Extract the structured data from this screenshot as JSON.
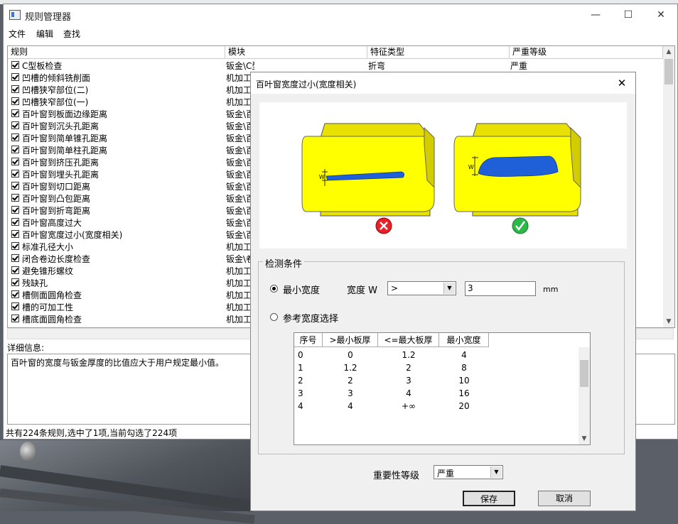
{
  "main_window": {
    "title": "规则管理器",
    "menu": [
      "文件",
      "编辑",
      "查找"
    ],
    "columns": [
      "规则",
      "模块",
      "特征类型",
      "严重等级"
    ],
    "rows": [
      {
        "rule": "C型板检查",
        "module": "钣金\\C型板",
        "feature": "折弯",
        "severity": "严重"
      },
      {
        "rule": "凹槽的倾斜铣削面",
        "module": "机加工"
      },
      {
        "rule": "凹槽狭窄部位(二)",
        "module": "机加工"
      },
      {
        "rule": "凹槽狭窄部位(一)",
        "module": "机加工"
      },
      {
        "rule": "百叶窗到板面边缘距离",
        "module": "钣金\\百"
      },
      {
        "rule": "百叶窗到沉头孔距离",
        "module": "钣金\\百"
      },
      {
        "rule": "百叶窗到简单锥孔距离",
        "module": "钣金\\百"
      },
      {
        "rule": "百叶窗到简单柱孔距离",
        "module": "钣金\\百"
      },
      {
        "rule": "百叶窗到挤压孔距离",
        "module": "钣金\\百"
      },
      {
        "rule": "百叶窗到埋头孔距离",
        "module": "钣金\\百"
      },
      {
        "rule": "百叶窗到切口距离",
        "module": "钣金\\百"
      },
      {
        "rule": "百叶窗到凸包距离",
        "module": "钣金\\百"
      },
      {
        "rule": "百叶窗到折弯距离",
        "module": "钣金\\百"
      },
      {
        "rule": "百叶窗高度过大",
        "module": "钣金\\百"
      },
      {
        "rule": "百叶窗宽度过小(宽度相关)",
        "module": "钣金\\百"
      },
      {
        "rule": "标准孔径大小",
        "module": "机加工"
      },
      {
        "rule": "闭合卷边长度检查",
        "module": "钣金\\卷"
      },
      {
        "rule": "避免锥形螺纹",
        "module": "机加工"
      },
      {
        "rule": "残缺孔",
        "module": "机加工"
      },
      {
        "rule": "槽侧面圆角检查",
        "module": "机加工"
      },
      {
        "rule": "槽的可加工性",
        "module": "机加工"
      },
      {
        "rule": "槽底面圆角检查",
        "module": "机加工"
      }
    ],
    "detail_label": "详细信息:",
    "detail_text": "百叶窗的宽度与钣金厚度的比值应大于用户规定最小值。",
    "status": "共有224条规则,选中了1项,当前勾选了224项"
  },
  "dialog": {
    "title": "百叶窗宽度过小(宽度相关)",
    "group_label": "检测条件",
    "option_min": "最小宽度",
    "width_label": "宽度 W",
    "operator": ">",
    "min_value": "3",
    "unit": "mm",
    "option_ref": "参考宽度选择",
    "table_headers": [
      "序号",
      ">最小板厚",
      "<=最大板厚",
      "最小宽度"
    ],
    "table_rows": [
      [
        "0",
        "0",
        "1.2",
        "4"
      ],
      [
        "1",
        "1.2",
        "2",
        "8"
      ],
      [
        "2",
        "2",
        "3",
        "10"
      ],
      [
        "3",
        "3",
        "4",
        "16"
      ],
      [
        "4",
        "4",
        "+∞",
        "20"
      ]
    ],
    "importance_label": "重要性等级",
    "importance_value": "严重",
    "save": "保存",
    "cancel": "取消",
    "dim_label": "W"
  }
}
